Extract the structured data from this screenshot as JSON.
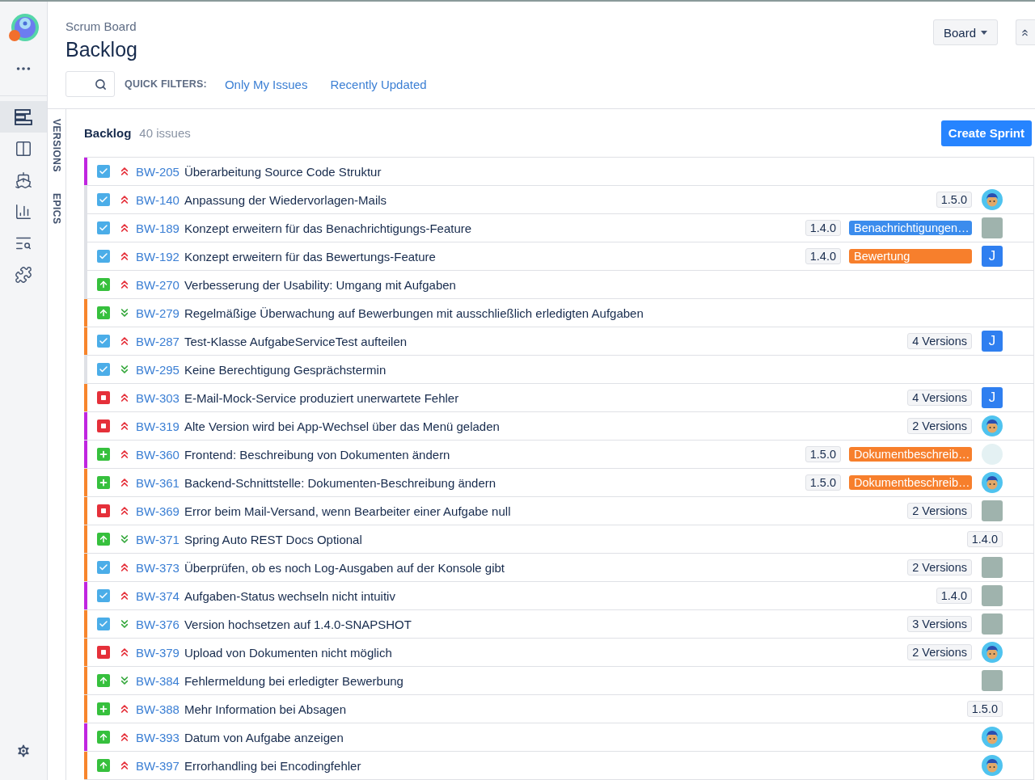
{
  "nav_items": [
    {
      "kind": "backlog",
      "selected": true
    },
    {
      "kind": "board",
      "selected": false
    },
    {
      "kind": "releases",
      "selected": false
    },
    {
      "kind": "reports",
      "selected": false
    },
    {
      "kind": "search",
      "selected": false
    },
    {
      "kind": "addons",
      "selected": false
    }
  ],
  "header": {
    "breadcrumb": "Scrum Board",
    "title": "Backlog",
    "board_button": "Board",
    "quick_filters_label": "QUICK FILTERS:",
    "quick_filters": [
      "Only My Issues",
      "Recently Updated"
    ]
  },
  "side_tabs": [
    "VERSIONS",
    "EPICS"
  ],
  "backlog": {
    "title": "Backlog",
    "count": "40 issues",
    "create_button": "Create Sprint",
    "issues": [
      {
        "type": {
          "kind": "task"
        },
        "priority": {
          "kind": "highest"
        },
        "color": "#c026e0",
        "key": "BW-205",
        "summary": "Überarbeitung Source Code Struktur"
      },
      {
        "type": {
          "kind": "task"
        },
        "priority": {
          "kind": "highest"
        },
        "key": "BW-140",
        "summary": "Anpassung der Wiedervorlagen-Mails",
        "version": "1.5.0",
        "avatar": {
          "kind": "cartoon"
        }
      },
      {
        "type": {
          "kind": "task"
        },
        "priority": {
          "kind": "highest"
        },
        "key": "BW-189",
        "summary": "Konzept erweitern für das Benachrichtigungs-Feature",
        "version": "1.4.0",
        "epic": {
          "label": "Benachrichtigungen…",
          "color": "#3b8ced"
        },
        "avatar": {
          "kind": "photo"
        }
      },
      {
        "type": {
          "kind": "task"
        },
        "priority": {
          "kind": "highest"
        },
        "key": "BW-192",
        "summary": "Konzept erweitern für das Bewertungs-Feature",
        "version": "1.4.0",
        "epic": {
          "label": "Bewertung",
          "color": "#f77f2c"
        },
        "avatar": {
          "kind": "letter",
          "letter": "J"
        }
      },
      {
        "type": {
          "kind": "improvement"
        },
        "priority": {
          "kind": "highest"
        },
        "key": "BW-270",
        "summary": "Verbesserung der Usability: Umgang mit Aufgaben"
      },
      {
        "type": {
          "kind": "improvement"
        },
        "priority": {
          "kind": "lowest"
        },
        "color": "#f7852c",
        "key": "BW-279",
        "summary": "Regelmäßige Überwachung auf Bewerbungen mit ausschließlich erledigten Aufgaben"
      },
      {
        "type": {
          "kind": "task"
        },
        "priority": {
          "kind": "highest"
        },
        "color": "#f7852c",
        "key": "BW-287",
        "summary": "Test-Klasse AufgabeServiceTest aufteilen",
        "version": "4 Versions",
        "avatar": {
          "kind": "letter",
          "letter": "J"
        }
      },
      {
        "type": {
          "kind": "task"
        },
        "priority": {
          "kind": "lowest"
        },
        "key": "BW-295",
        "summary": "Keine Berechtigung Gesprächstermin"
      },
      {
        "type": {
          "kind": "bug"
        },
        "priority": {
          "kind": "highest"
        },
        "color": "#f7852c",
        "key": "BW-303",
        "summary": "E-Mail-Mock-Service produziert unerwartete Fehler",
        "version": "4 Versions",
        "avatar": {
          "kind": "letter",
          "letter": "J"
        }
      },
      {
        "type": {
          "kind": "bug"
        },
        "priority": {
          "kind": "highest"
        },
        "color": "#c026e0",
        "key": "BW-319",
        "summary": "Alte Version wird bei App-Wechsel über das Menü geladen",
        "version": "2 Versions",
        "avatar": {
          "kind": "cartoon"
        }
      },
      {
        "type": {
          "kind": "feature"
        },
        "priority": {
          "kind": "highest"
        },
        "color": "#c026e0",
        "key": "BW-360",
        "summary": "Frontend: Beschreibung von Dokumenten ändern",
        "version": "1.5.0",
        "epic": {
          "label": "Dokumentbeschreib…",
          "color": "#f77f2c"
        },
        "avatar": {
          "kind": "default"
        }
      },
      {
        "type": {
          "kind": "feature"
        },
        "priority": {
          "kind": "highest"
        },
        "color": "#f7852c",
        "key": "BW-361",
        "summary": "Backend-Schnittstelle: Dokumenten-Beschreibung ändern",
        "version": "1.5.0",
        "epic": {
          "label": "Dokumentbeschreib…",
          "color": "#f77f2c"
        },
        "avatar": {
          "kind": "cartoon"
        }
      },
      {
        "type": {
          "kind": "bug"
        },
        "priority": {
          "kind": "highest"
        },
        "color": "#f7852c",
        "key": "BW-369",
        "summary": "Error beim Mail-Versand, wenn Bearbeiter einer Aufgabe null",
        "version": "2 Versions",
        "avatar": {
          "kind": "photo"
        }
      },
      {
        "type": {
          "kind": "improvement"
        },
        "priority": {
          "kind": "lowest"
        },
        "color": "#f7852c",
        "key": "BW-371",
        "summary": "Spring Auto REST Docs Optional",
        "version": "1.4.0"
      },
      {
        "type": {
          "kind": "task"
        },
        "priority": {
          "kind": "highest"
        },
        "color": "#f7852c",
        "key": "BW-373",
        "summary": "Überprüfen, ob es noch Log-Ausgaben auf der Konsole gibt",
        "version": "2 Versions",
        "avatar": {
          "kind": "photo"
        }
      },
      {
        "type": {
          "kind": "task"
        },
        "priority": {
          "kind": "highest"
        },
        "color": "#c026e0",
        "key": "BW-374",
        "summary": "Aufgaben-Status wechseln nicht intuitiv",
        "version": "1.4.0",
        "avatar": {
          "kind": "photo"
        }
      },
      {
        "type": {
          "kind": "task"
        },
        "priority": {
          "kind": "lowest"
        },
        "color": "#f7852c",
        "key": "BW-376",
        "summary": "Version hochsetzen auf 1.4.0-SNAPSHOT",
        "version": "3 Versions",
        "avatar": {
          "kind": "photo"
        }
      },
      {
        "type": {
          "kind": "bug"
        },
        "priority": {
          "kind": "highest"
        },
        "color": "#f7852c",
        "key": "BW-379",
        "summary": "Upload von Dokumenten nicht möglich",
        "version": "2 Versions",
        "avatar": {
          "kind": "cartoon"
        }
      },
      {
        "type": {
          "kind": "improvement"
        },
        "priority": {
          "kind": "lowest"
        },
        "color": "#f7852c",
        "key": "BW-384",
        "summary": "Fehlermeldung bei erledigter Bewerbung",
        "avatar": {
          "kind": "photo"
        }
      },
      {
        "type": {
          "kind": "feature"
        },
        "priority": {
          "kind": "highest"
        },
        "color": "#f7852c",
        "key": "BW-388",
        "summary": "Mehr Information bei Absagen",
        "version": "1.5.0"
      },
      {
        "type": {
          "kind": "improvement"
        },
        "priority": {
          "kind": "highest"
        },
        "color": "#c026e0",
        "key": "BW-393",
        "summary": "Datum von Aufgabe anzeigen",
        "avatar": {
          "kind": "cartoon"
        }
      },
      {
        "type": {
          "kind": "improvement"
        },
        "priority": {
          "kind": "highest"
        },
        "color": "#f7852c",
        "key": "BW-397",
        "summary": "Errorhandling bei Encodingfehler",
        "avatar": {
          "kind": "cartoon"
        }
      }
    ]
  }
}
